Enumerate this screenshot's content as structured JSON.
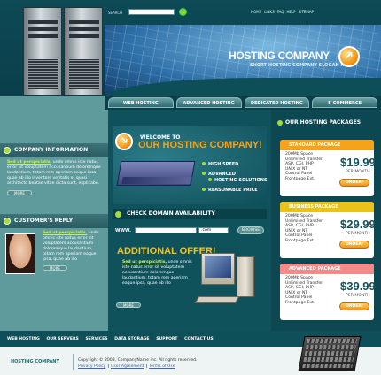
{
  "header": {
    "search_label": "SEARCH",
    "search_go": "»",
    "toplinks": [
      "HOME",
      "LINKS",
      "FAQ",
      "HELP",
      "SITEMAP"
    ],
    "brand": "HOSTING COMPANY",
    "slogan": "SHORT HOSTING COMPANY SLOGAN HERE"
  },
  "nav": [
    "WEB HOSTING",
    "ADVANCED HOSTING",
    "DEDICATED HOSTING",
    "E-COMMERCE"
  ],
  "left": {
    "company_title": "COMPANY INFORMATION",
    "company_link": "Sed ut perspiciatis,",
    "company_text": "unde omnis iste natus error sit voluptatem accusantium doloremque laudantium, totam rem aperiam eaque ipsa, quae ab illo inventore veritatis et quasi architecto beatae vitae dicta sunt, explicabo.",
    "more": "MORE",
    "reply_title": "CUSTOMER'S REPLY",
    "reply_link": "Sed ut perspiciatis,",
    "reply_text": "unde omnis iste natus error sit voluptatem accusantium doloremque laudantium, totam rem aperiam eaque ipsa, quae ab illo",
    "more2": "MORE"
  },
  "welcome": {
    "line1": "WELCOME TO",
    "line2": "OUR HOSTING COMPANY!",
    "features": [
      "HIGH SPEED",
      "ADVANCED",
      "HOSTING SOLUTIONS",
      "REASONABLE PRICE"
    ]
  },
  "domain": {
    "title": "CHECK DOMAIN AVAILABILITY",
    "www": "WWW.",
    "tld": ".com",
    "browse": "BROWSE"
  },
  "offer": {
    "title": "ADDITIONAL OFFER!",
    "link": "Sed ut perspiciatis,",
    "text": "unde omnis iste natus error sit voluptatem accusantium doloremque laudantium, totam rem aperiam eaque ipsa, quae ab illo",
    "more": "MORE"
  },
  "packages": {
    "title": "OUR HOSTING PACKAGES",
    "items": [
      {
        "name": "STANDARD PACKAGE",
        "features": [
          "200Mb Space",
          "Unlimited Transfer",
          "ASP, CGI, PHP",
          "UNIX or NT",
          "Control Panel",
          "Frontpage Ext."
        ],
        "price": "$19.99",
        "per": "PER MONTH",
        "order": "ORDER!",
        "color": "#f5a31a"
      },
      {
        "name": "BUSINESS PACKAGE",
        "features": [
          "200Mb Space",
          "Unlimited Transfer",
          "ASP, CGI, PHP",
          "UNIX or NT",
          "Control Panel",
          "Frontpage Ext."
        ],
        "price": "$29.99",
        "per": "PER MONTH",
        "order": "ORDER!",
        "color": "#e9c21b"
      },
      {
        "name": "ADVANCED PACKAGE",
        "features": [
          "200Mb Space",
          "Unlimited Transfer",
          "ASP, CGI, PHP",
          "UNIX or NT",
          "Control Panel",
          "Frontpage Ext."
        ],
        "price": "$39.99",
        "per": "PER MONTH",
        "order": "ORDER!",
        "color": "#f48b8b"
      }
    ]
  },
  "bottomnav": [
    "WEB HOSTING",
    "OUR SERVERS",
    "SERVICES",
    "DATA STORAGE",
    "SUPPORT",
    "CONTACT US"
  ],
  "footer": {
    "logo": "HOSTING COMPANY",
    "copyright": "Copyright © 2003, CompanyName inc. All rights reserved.",
    "links": [
      "Privacy Policy",
      "User Agreement",
      "Terms of Use"
    ]
  }
}
